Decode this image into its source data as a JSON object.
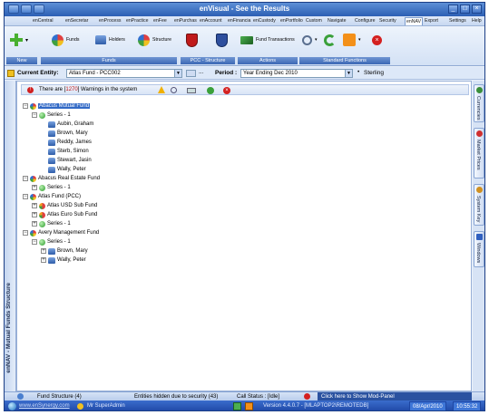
{
  "window": {
    "title": "enVisual - See the Results"
  },
  "menu": {
    "items": [
      "enCentral",
      "enSecretar",
      "enProcess",
      "enPractice",
      "enFee",
      "enPurchas",
      "enAccount",
      "enFinancia",
      "enCustody",
      "enPortfolio",
      "Custom",
      "Navigate",
      "Configure",
      "Security",
      "enNAV",
      "Export",
      "Settings",
      "Help"
    ],
    "active": "enNAV"
  },
  "ribbon": {
    "buttons": {
      "funds": "Funds",
      "holders": "Holders",
      "structure": "Structure",
      "fund_transactions": "Fund Transactions"
    },
    "groups": {
      "new": "New",
      "funds": "Funds",
      "pcc": "PCC - Structure",
      "actions": "Actions",
      "standard": "Standard Functions"
    }
  },
  "entity_bar": {
    "entity_label": "Current Entity:",
    "entity_value": "Atlas Fund - PCC002",
    "period_label": "Period :",
    "period_value": "Year Ending Dec 2010",
    "currency": "Sterling"
  },
  "warnings": {
    "prefix": "There are [",
    "count": "1270",
    "suffix": "] Warnings in the system"
  },
  "left_caption": "enNAV - Mutual Funds Structure",
  "tree": {
    "abacus": "Abacus Mutual Fund",
    "abacus_series": "Series - 1",
    "people": [
      "Aubin, Graham",
      "Brown, Mary",
      "Reddy, James",
      "Sterb, Simon",
      "Stewart, Jasin",
      "Wally, Peter"
    ],
    "real_estate": "Abacus Real Estate Fund",
    "real_estate_series": "Series - 1",
    "atlas": "Atlas Fund (PCC)",
    "atlas_usd": "Atlas USD Sub Fund",
    "atlas_euro": "Atlas Euro Sub Fund",
    "atlas_series": "Series - 1",
    "avery": "Avery Management Fund",
    "avery_series": "Series - 1",
    "avery_people": [
      "Brown, Mary",
      "Wally, Peter"
    ]
  },
  "right_tabs": [
    "Currencies",
    "Market Prices",
    "System Key",
    "Windows"
  ],
  "status": {
    "fund_structure": "Fund Structure  (4)",
    "hidden": "Entities hidden due to security (43)",
    "call_status": "Call Status : [Idle]",
    "mod_panel": "Click here to Show Mod-Panel"
  },
  "taskbar": {
    "url": "www.enSynergy.com",
    "user": "Mr SuperAdmin",
    "version": "Version 4.4.0.7 - [MLAPTOP2\\REMOTEDB]",
    "date": "08/Apr/2010",
    "time": "10:55:32"
  }
}
